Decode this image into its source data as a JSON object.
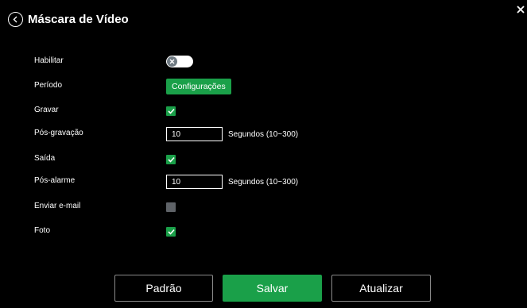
{
  "dialog": {
    "title": "Máscara de Vídeo"
  },
  "fields": {
    "enable": {
      "label": "Habilitar",
      "on": false
    },
    "period": {
      "label": "Período",
      "button_label": "Configurações"
    },
    "record": {
      "label": "Gravar",
      "checked": true
    },
    "post_record": {
      "label": "Pós-gravação",
      "value": "10",
      "unit": "Segundos (10~300)"
    },
    "output": {
      "label": "Saída",
      "checked": true
    },
    "post_alarm": {
      "label": "Pós-alarme",
      "value": "10",
      "unit": "Segundos (10~300)"
    },
    "send_email": {
      "label": "Enviar e-mail",
      "checked": false
    },
    "photo": {
      "label": "Foto",
      "checked": true
    }
  },
  "footer": {
    "default_label": "Padrão",
    "save_label": "Salvar",
    "refresh_label": "Atualizar"
  },
  "colors": {
    "accent": "#1aa049",
    "background": "#000000",
    "unchecked": "#5f6368"
  },
  "icons": [
    "back-icon",
    "close-icon",
    "toggle-off-icon",
    "check-icon"
  ]
}
